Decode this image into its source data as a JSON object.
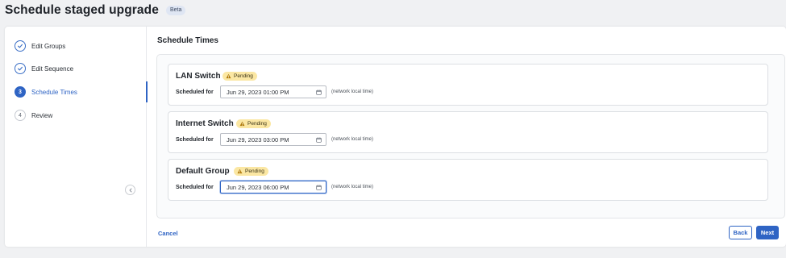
{
  "header": {
    "title": "Schedule staged upgrade",
    "badge": "Beta"
  },
  "steps": [
    {
      "number": "1",
      "label": "Edit Groups",
      "state": "done",
      "icon": "check-icon"
    },
    {
      "number": "2",
      "label": "Edit Sequence",
      "state": "done",
      "icon": "check-icon"
    },
    {
      "number": "3",
      "label": "Schedule Times",
      "state": "active"
    },
    {
      "number": "4",
      "label": "Review",
      "state": "pending"
    }
  ],
  "main": {
    "section_title": "Schedule Times",
    "devices": [
      {
        "name": "LAN Switch",
        "status": "Pending",
        "scheduled_label": "Scheduled for",
        "date": "Jun 29, 2023 01:00 PM",
        "tz_note": "(network local time)"
      },
      {
        "name": "Internet Switch",
        "status": "Pending",
        "scheduled_label": "Scheduled for",
        "date": "Jun 29, 2023 03:00 PM",
        "tz_note": "(network local time)"
      },
      {
        "name": "Default Group",
        "status": "Pending",
        "scheduled_label": "Scheduled for",
        "date": "Jun 29, 2023 06:00 PM",
        "tz_note": "(network local time)"
      }
    ]
  },
  "footer": {
    "cancel": "Cancel",
    "back": "Back",
    "next": "Next"
  },
  "colors": {
    "accent": "#2f64c4",
    "pending_badge": "#fbe7a3",
    "background": "#f0f1f3"
  }
}
